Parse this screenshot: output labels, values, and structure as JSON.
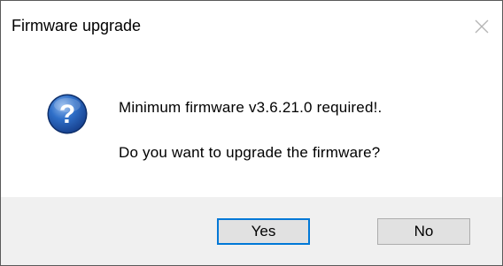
{
  "window": {
    "title": "Firmware upgrade",
    "close_icon": "close-icon"
  },
  "message": {
    "icon": "question-icon",
    "line1": "Minimum firmware v3.6.21.0 required!.",
    "line2": "Do you want to upgrade the firmware?"
  },
  "buttons": {
    "yes_label": "Yes",
    "no_label": "No"
  },
  "colors": {
    "button_bar_background": "#f0f0f0",
    "default_button_border": "#0078d7",
    "icon_blue": "#1f5fb3"
  }
}
